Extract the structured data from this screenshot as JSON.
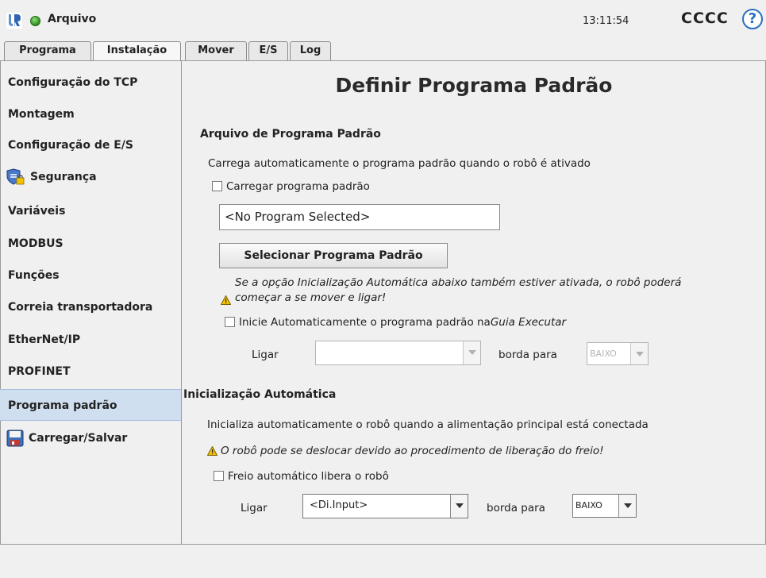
{
  "header": {
    "file_title": "Arquivo",
    "clock": "13:11:54",
    "robot_name": "CCCC",
    "help_label": "?"
  },
  "tabs": [
    {
      "label": "Programa"
    },
    {
      "label": "Instalação"
    },
    {
      "label": "Mover"
    },
    {
      "label": "E/S"
    },
    {
      "label": "Log"
    }
  ],
  "sidebar": {
    "items": [
      {
        "label": "Configuração do TCP"
      },
      {
        "label": "Montagem"
      },
      {
        "label": "Configuração de E/S"
      },
      {
        "label": "Segurança",
        "icon": "security-shield-icon"
      },
      {
        "label": "Variáveis"
      },
      {
        "label": "MODBUS"
      },
      {
        "label": "Funções"
      },
      {
        "label": "Correia transportadora"
      },
      {
        "label": "EtherNet/IP"
      },
      {
        "label": "PROFINET"
      },
      {
        "label": "Programa padrão"
      },
      {
        "label": "Carregar/Salvar",
        "icon": "floppy-disk-icon"
      }
    ],
    "selected": "Programa padrão"
  },
  "main": {
    "title": "Definir Programa Padrão",
    "default_program": {
      "heading": "Arquivo de Programa Padrão",
      "description": "Carrega automaticamente o programa padrão quando o robô é ativado",
      "load_checkbox_label": "Carregar programa padrão",
      "load_checked": false,
      "program_field_value": "<No Program Selected>",
      "select_button_label": "Selecionar Programa Padrão",
      "warning_line1": "Se a opção Inicialização Automática abaixo também estiver ativada, o robô poderá",
      "warning_line2": "começar a se mover e ligar!",
      "autostart_label_prefix": "Inicie Automaticamente o programa padrão na",
      "autostart_label_italic": "Guia Executar",
      "autostart_checked": false,
      "turn_on_label": "Ligar",
      "turn_on_value": "",
      "edge_label": "borda para",
      "edge_value": "BAIXO"
    },
    "auto_init": {
      "heading": "Inicialização Automática",
      "description": "Inicializa automaticamente o robô quando a alimentação principal está conectada",
      "warning": "O robô pode se deslocar devido ao procedimento de liberação do freio!",
      "brake_checkbox_label": "Freio automático libera o robô",
      "brake_checked": false,
      "turn_on_label": "Ligar",
      "turn_on_value": "<Di.Input>",
      "edge_label": "borda para",
      "edge_value": "BAIXO"
    }
  },
  "colors": {
    "selection": "#cfdff0",
    "accent": "#2a6fbf",
    "warning": "#f2c200"
  }
}
